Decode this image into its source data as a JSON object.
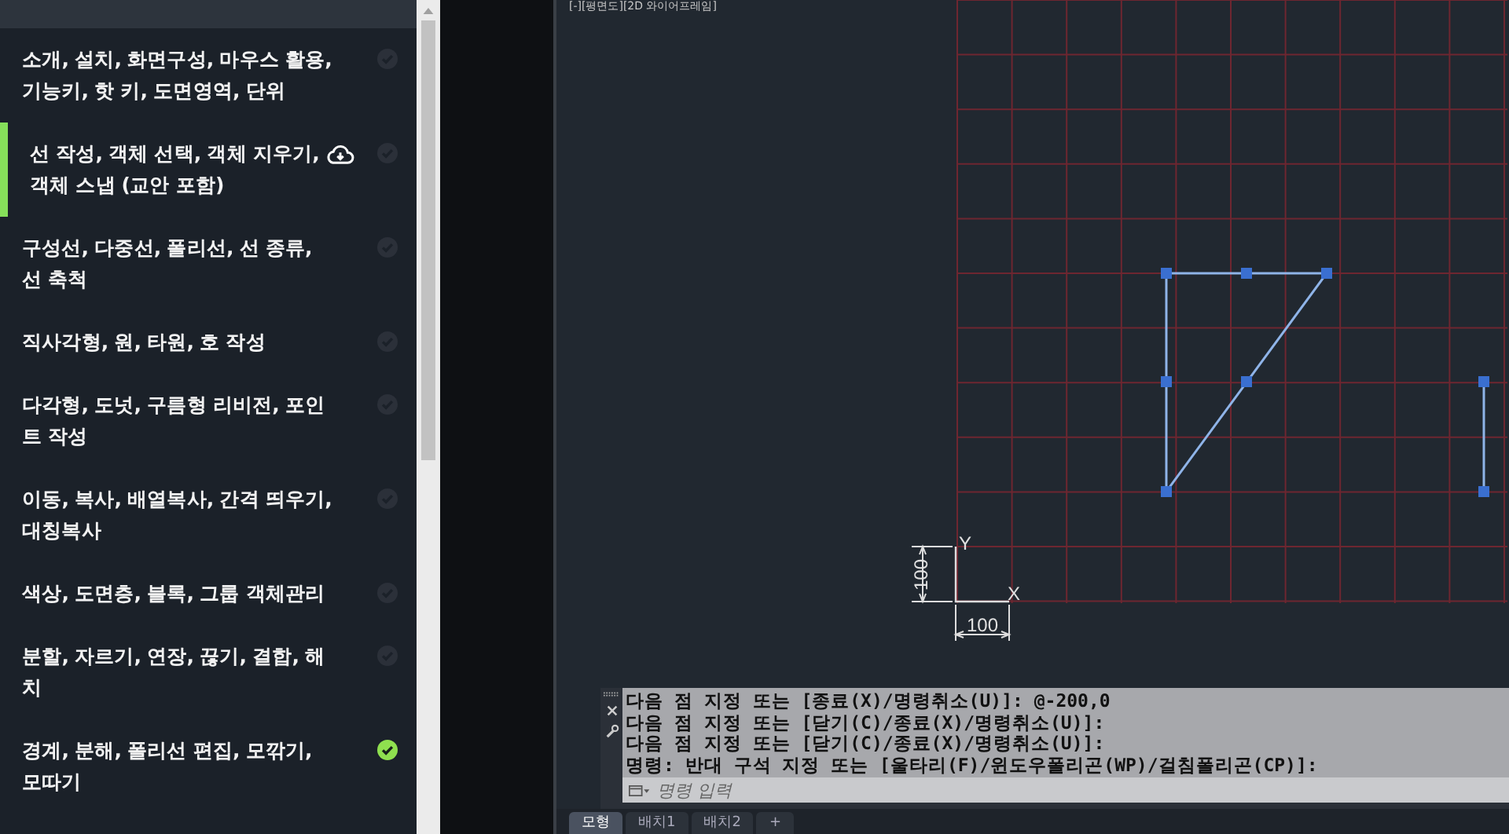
{
  "lessons": [
    {
      "title": "소개, 설치, 화면구성, 마우스 활용,\n기능키, 핫 키, 도면영역, 단위",
      "selected": false,
      "done": false,
      "download": false
    },
    {
      "title": "선 작성, 객체 선택, 객체 지우기,\n객체 스냅 (교안 포함)",
      "selected": true,
      "done": false,
      "download": true
    },
    {
      "title": "구성선, 다중선, 폴리선, 선 종류,\n선 축척",
      "selected": false,
      "done": false,
      "download": false
    },
    {
      "title": "직사각형, 원, 타원, 호 작성",
      "selected": false,
      "done": false,
      "download": false
    },
    {
      "title": "다각형, 도넛, 구름형 리비전, 포인\n트 작성",
      "selected": false,
      "done": false,
      "download": false
    },
    {
      "title": "이동, 복사, 배열복사, 간격 띄우기,\n대칭복사",
      "selected": false,
      "done": false,
      "download": false
    },
    {
      "title": "색상, 도면층, 블록, 그룹 객체관리",
      "selected": false,
      "done": false,
      "download": false
    },
    {
      "title": "분할, 자르기, 연장, 끊기, 결합, 해\n치",
      "selected": false,
      "done": false,
      "download": false
    },
    {
      "title": "경계, 분해, 폴리선 편집, 모깎기,\n모따기",
      "selected": false,
      "done": true,
      "download": false
    }
  ],
  "viewport": {
    "label": "[-][평면도][2D 와이어프레임]"
  },
  "drawing": {
    "axis_y": "Y",
    "axis_x": "X",
    "dim_vertical": "100",
    "dim_horizontal": "100"
  },
  "command_history": [
    "다음 점 지정 또는 [종료(X)/명령취소(U)]: @-200,0",
    "다음 점 지정 또는 [닫기(C)/종료(X)/명령취소(U)]:",
    "다음 점 지정 또는 [닫기(C)/종료(X)/명령취소(U)]:",
    "명령: 반대 구석 지정 또는 [울타리(F)/윈도우폴리곤(WP)/걸침폴리곤(CP)]:"
  ],
  "command_input": {
    "placeholder": "명령 입력"
  },
  "layout_tabs": [
    {
      "label": "모형",
      "selected": true
    },
    {
      "label": "배치1",
      "selected": false
    },
    {
      "label": "배치2",
      "selected": false
    },
    {
      "label": "+",
      "selected": false
    }
  ]
}
